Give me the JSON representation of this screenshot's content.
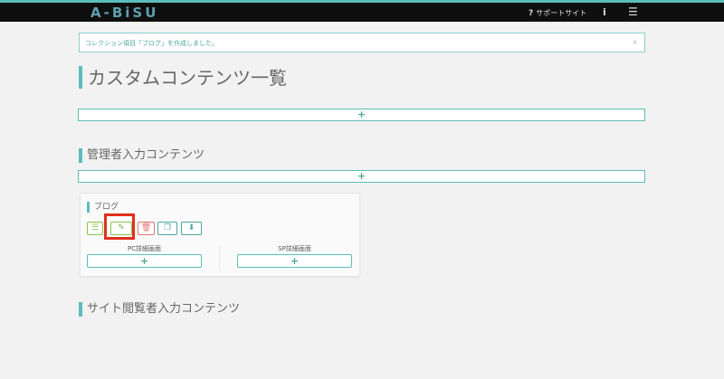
{
  "header": {
    "logo": "A-BiSU",
    "help_label": "サポートサイト",
    "info_icon": "info-icon",
    "menu_icon": "menu-icon"
  },
  "alert": {
    "message": "コレクション項目「ブログ」を作成しました。",
    "close": "×"
  },
  "page": {
    "title": "カスタムコンテンツ一覧",
    "add_label": "+"
  },
  "admin_section": {
    "title": "管理者入力コンテンツ",
    "add_label": "+",
    "card": {
      "title": "ブログ",
      "buttons": {
        "list": "☰",
        "edit": "✎",
        "delete": "🗑",
        "copy": "❐",
        "download": "⬇"
      },
      "pc_label": "PC詳細画面",
      "sp_label": "SP詳細画面",
      "pc_add": "+",
      "sp_add": "+"
    }
  },
  "visitor_section": {
    "title": "サイト閲覧者入力コンテンツ"
  },
  "colors": {
    "accent": "#5bbdbb",
    "highlight": "#e0301e"
  }
}
